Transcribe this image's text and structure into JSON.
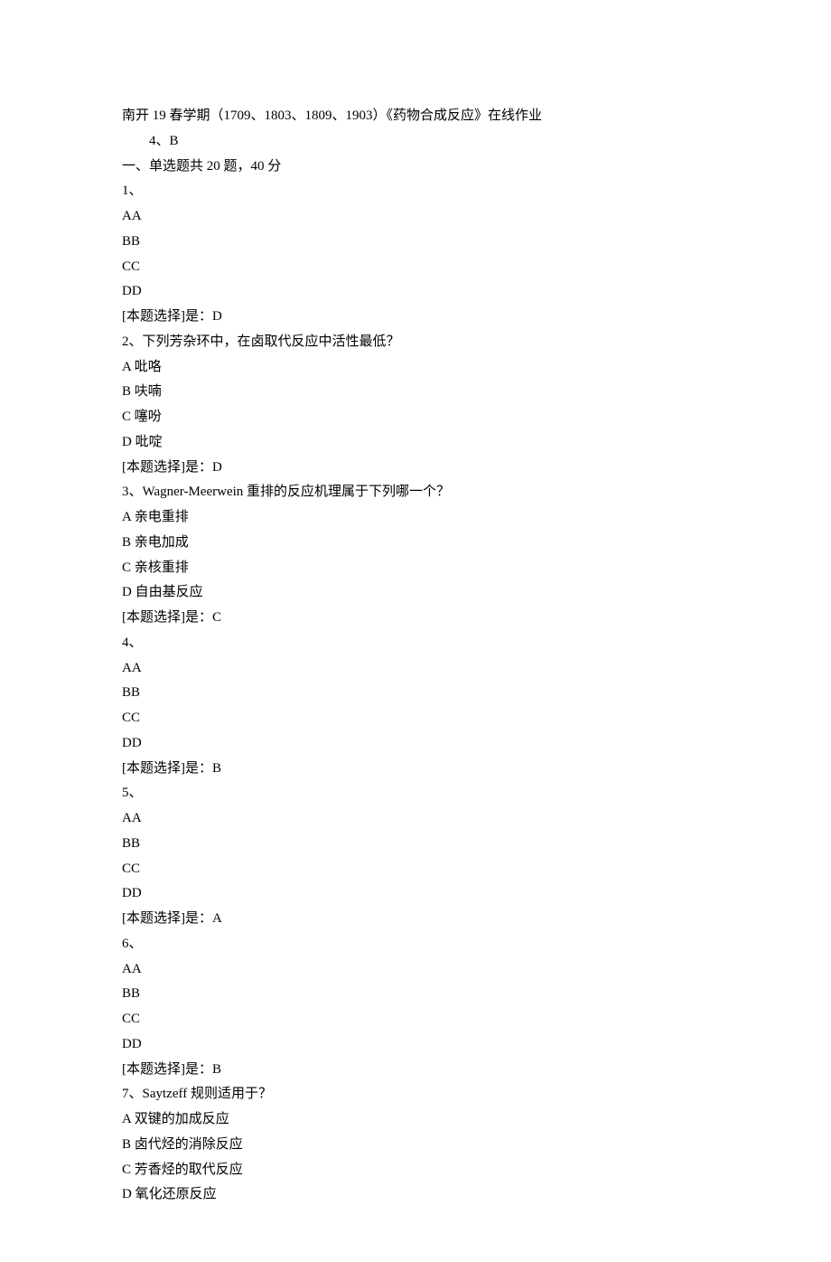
{
  "header": {
    "title": "南开 19 春学期（1709、1803、1809、1903）《药物合成反应》在线作业",
    "subline": "4、B",
    "section": "一、单选题共 20 题，40 分"
  },
  "questions": [
    {
      "stem": "1、",
      "options": [
        "AA",
        "BB",
        "CC",
        "DD"
      ],
      "answer": "[本题选择]是：D"
    },
    {
      "stem": "2、下列芳杂环中，在卤取代反应中活性最低？",
      "options": [
        "A 吡咯",
        "B 呋喃",
        "C 噻吩",
        "D 吡啶"
      ],
      "answer": "[本题选择]是：D"
    },
    {
      "stem": "3、Wagner-Meerwein 重排的反应机理属于下列哪一个？",
      "options": [
        "A 亲电重排",
        "B 亲电加成",
        "C 亲核重排",
        "D 自由基反应"
      ],
      "answer": "[本题选择]是：C"
    },
    {
      "stem": "4、",
      "options": [
        "AA",
        "BB",
        "CC",
        "DD"
      ],
      "answer": "[本题选择]是：B"
    },
    {
      "stem": "5、",
      "options": [
        "AA",
        "BB",
        "CC",
        "DD"
      ],
      "answer": "[本题选择]是：A"
    },
    {
      "stem": "6、",
      "options": [
        "AA",
        "BB",
        "CC",
        "DD"
      ],
      "answer": "[本题选择]是：B"
    },
    {
      "stem": "7、Saytzeff 规则适用于？",
      "options": [
        "A 双键的加成反应",
        "B 卤代烃的消除反应",
        "C 芳香烃的取代反应",
        "D 氧化还原反应"
      ],
      "answer": ""
    }
  ]
}
